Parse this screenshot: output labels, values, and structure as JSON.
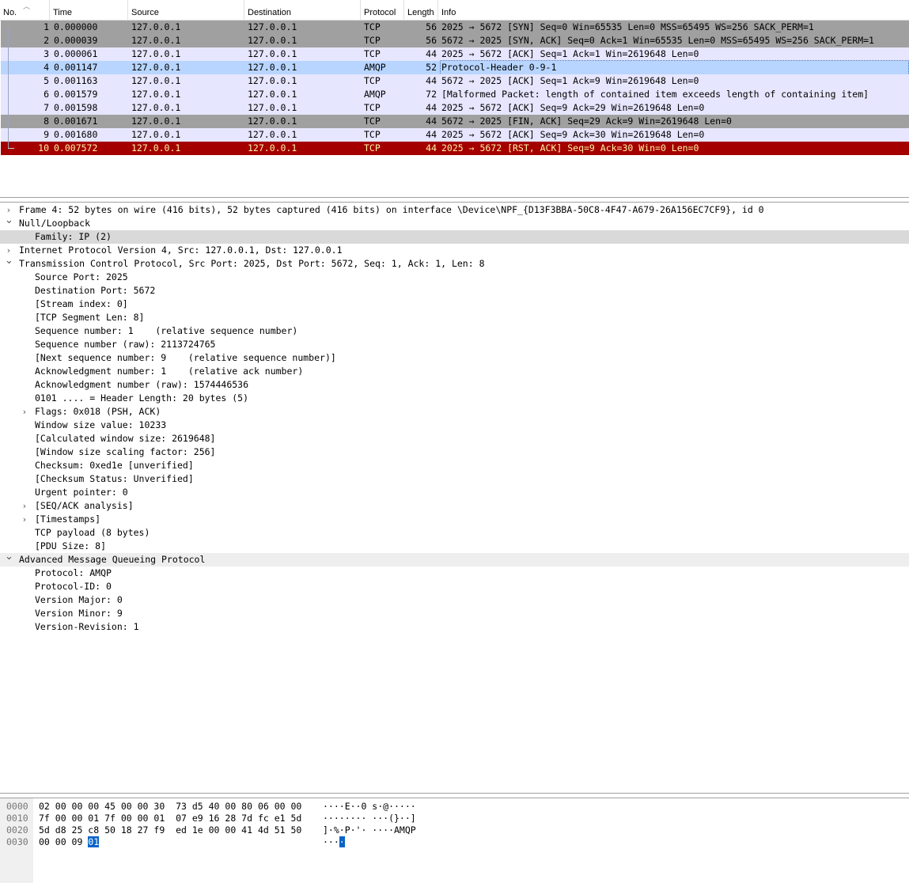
{
  "colors": {
    "row_default_bg": "#e7e6ff",
    "row_gray_bg": "#a0a0a0",
    "row_selected_bg": "#b8d5ff",
    "row_rst_bg": "#a40000",
    "row_rst_fg": "#fff3a4",
    "tree_selected_bg": "#d9d9d9",
    "byte_highlight_bg": "#0a64c8"
  },
  "packet_list": {
    "columns": [
      "No.",
      "Time",
      "Source",
      "Destination",
      "Protocol",
      "Length",
      "Info"
    ],
    "rows": [
      {
        "no": "1",
        "time": "0.000000",
        "src": "127.0.0.1",
        "dst": "127.0.0.1",
        "proto": "TCP",
        "len": "56",
        "info": "2025 → 5672 [SYN] Seq=0 Win=65535 Len=0 MSS=65495 WS=256 SACK_PERM=1",
        "style": "gray"
      },
      {
        "no": "2",
        "time": "0.000039",
        "src": "127.0.0.1",
        "dst": "127.0.0.1",
        "proto": "TCP",
        "len": "56",
        "info": "5672 → 2025 [SYN, ACK] Seq=0 Ack=1 Win=65535 Len=0 MSS=65495 WS=256 SACK_PERM=1",
        "style": "gray"
      },
      {
        "no": "3",
        "time": "0.000061",
        "src": "127.0.0.1",
        "dst": "127.0.0.1",
        "proto": "TCP",
        "len": "44",
        "info": "2025 → 5672 [ACK] Seq=1 Ack=1 Win=2619648 Len=0",
        "style": "default"
      },
      {
        "no": "4",
        "time": "0.001147",
        "src": "127.0.0.1",
        "dst": "127.0.0.1",
        "proto": "AMQP",
        "len": "52",
        "info": "Protocol-Header 0-9-1",
        "style": "selected"
      },
      {
        "no": "5",
        "time": "0.001163",
        "src": "127.0.0.1",
        "dst": "127.0.0.1",
        "proto": "TCP",
        "len": "44",
        "info": "5672 → 2025 [ACK] Seq=1 Ack=9 Win=2619648 Len=0",
        "style": "default"
      },
      {
        "no": "6",
        "time": "0.001579",
        "src": "127.0.0.1",
        "dst": "127.0.0.1",
        "proto": "AMQP",
        "len": "72",
        "info": "[Malformed Packet: length of contained item exceeds length of containing item]",
        "style": "default"
      },
      {
        "no": "7",
        "time": "0.001598",
        "src": "127.0.0.1",
        "dst": "127.0.0.1",
        "proto": "TCP",
        "len": "44",
        "info": "2025 → 5672 [ACK] Seq=9 Ack=29 Win=2619648 Len=0",
        "style": "default"
      },
      {
        "no": "8",
        "time": "0.001671",
        "src": "127.0.0.1",
        "dst": "127.0.0.1",
        "proto": "TCP",
        "len": "44",
        "info": "5672 → 2025 [FIN, ACK] Seq=29 Ack=9 Win=2619648 Len=0",
        "style": "gray"
      },
      {
        "no": "9",
        "time": "0.001680",
        "src": "127.0.0.1",
        "dst": "127.0.0.1",
        "proto": "TCP",
        "len": "44",
        "info": "2025 → 5672 [ACK] Seq=9 Ack=30 Win=2619648 Len=0",
        "style": "default"
      },
      {
        "no": "10",
        "time": "0.007572",
        "src": "127.0.0.1",
        "dst": "127.0.0.1",
        "proto": "TCP",
        "len": "44",
        "info": "2025 → 5672 [RST, ACK] Seq=9 Ack=30 Win=0 Len=0",
        "style": "rst"
      }
    ]
  },
  "detail_tree": [
    {
      "indent": 0,
      "arrow": "collapsed",
      "text": "Frame 4: 52 bytes on wire (416 bits), 52 bytes captured (416 bits) on interface \\Device\\NPF_{D13F3BBA-50C8-4F47-A679-26A156EC7CF9}, id 0"
    },
    {
      "indent": 0,
      "arrow": "expanded",
      "text": "Null/Loopback"
    },
    {
      "indent": 1,
      "arrow": "none",
      "text": "Family: IP (2)",
      "selected": true
    },
    {
      "indent": 0,
      "arrow": "collapsed",
      "text": "Internet Protocol Version 4, Src: 127.0.0.1, Dst: 127.0.0.1"
    },
    {
      "indent": 0,
      "arrow": "expanded",
      "text": "Transmission Control Protocol, Src Port: 2025, Dst Port: 5672, Seq: 1, Ack: 1, Len: 8"
    },
    {
      "indent": 1,
      "arrow": "none",
      "text": "Source Port: 2025"
    },
    {
      "indent": 1,
      "arrow": "none",
      "text": "Destination Port: 5672"
    },
    {
      "indent": 1,
      "arrow": "none",
      "text": "[Stream index: 0]"
    },
    {
      "indent": 1,
      "arrow": "none",
      "text": "[TCP Segment Len: 8]"
    },
    {
      "indent": 1,
      "arrow": "none",
      "text": "Sequence number: 1    (relative sequence number)"
    },
    {
      "indent": 1,
      "arrow": "none",
      "text": "Sequence number (raw): 2113724765"
    },
    {
      "indent": 1,
      "arrow": "none",
      "text": "[Next sequence number: 9    (relative sequence number)]"
    },
    {
      "indent": 1,
      "arrow": "none",
      "text": "Acknowledgment number: 1    (relative ack number)"
    },
    {
      "indent": 1,
      "arrow": "none",
      "text": "Acknowledgment number (raw): 1574446536"
    },
    {
      "indent": 1,
      "arrow": "none",
      "text": "0101 .... = Header Length: 20 bytes (5)"
    },
    {
      "indent": 1,
      "arrow": "collapsed",
      "text": "Flags: 0x018 (PSH, ACK)"
    },
    {
      "indent": 1,
      "arrow": "none",
      "text": "Window size value: 10233"
    },
    {
      "indent": 1,
      "arrow": "none",
      "text": "[Calculated window size: 2619648]"
    },
    {
      "indent": 1,
      "arrow": "none",
      "text": "[Window size scaling factor: 256]"
    },
    {
      "indent": 1,
      "arrow": "none",
      "text": "Checksum: 0xed1e [unverified]"
    },
    {
      "indent": 1,
      "arrow": "none",
      "text": "[Checksum Status: Unverified]"
    },
    {
      "indent": 1,
      "arrow": "none",
      "text": "Urgent pointer: 0"
    },
    {
      "indent": 1,
      "arrow": "collapsed",
      "text": "[SEQ/ACK analysis]"
    },
    {
      "indent": 1,
      "arrow": "collapsed",
      "text": "[Timestamps]"
    },
    {
      "indent": 1,
      "arrow": "none",
      "text": "TCP payload (8 bytes)"
    },
    {
      "indent": 1,
      "arrow": "none",
      "text": "[PDU Size: 8]"
    },
    {
      "indent": 0,
      "arrow": "expanded",
      "text": "Advanced Message Queueing Protocol",
      "band": true
    },
    {
      "indent": 1,
      "arrow": "none",
      "text": "Protocol: AMQP"
    },
    {
      "indent": 1,
      "arrow": "none",
      "text": "Protocol-ID: 0"
    },
    {
      "indent": 1,
      "arrow": "none",
      "text": "Version Major: 0"
    },
    {
      "indent": 1,
      "arrow": "none",
      "text": "Version Minor: 9"
    },
    {
      "indent": 1,
      "arrow": "none",
      "text": "Version-Revision: 1"
    }
  ],
  "hex_dump": [
    {
      "offset": "0000",
      "bytes": "02 00 00 00 45 00 00 30  73 d5 40 00 80 06 00 00",
      "ascii": "····E··0 s·@·····"
    },
    {
      "offset": "0010",
      "bytes": "7f 00 00 01 7f 00 00 01  07 e9 16 28 7d fc e1 5d",
      "ascii": "········ ···(}··]"
    },
    {
      "offset": "0020",
      "bytes": "5d d8 25 c8 50 18 27 f9  ed 1e 00 00 41 4d 51 50",
      "ascii": "]·%·P·'· ····AMQP"
    },
    {
      "offset": "0030",
      "bytes_plain": "00 00 09 ",
      "bytes_hl": "01",
      "ascii_plain": "···",
      "ascii_hl": "·"
    }
  ]
}
